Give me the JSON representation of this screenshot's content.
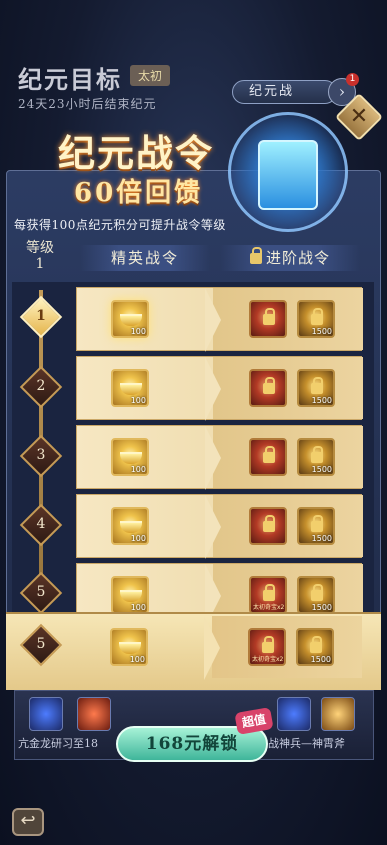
{
  "header": {
    "title": "纪元目标",
    "badge": "太初",
    "subtitle": "24天23小时后结束纪元",
    "war_button": "纪元战",
    "notify_count": "1"
  },
  "banner": {
    "title": "纪元战令",
    "subtitle": "60倍回馈",
    "description": "每获得100点纪元积分可提升战令等级"
  },
  "columns": {
    "level_label": "等级",
    "level_value": "1",
    "elite": "精英战令",
    "advanced": "进阶战令"
  },
  "rows": [
    {
      "level": "1",
      "elite_qty": "100",
      "adv_qty": "1500",
      "active": true
    },
    {
      "level": "2",
      "elite_qty": "100",
      "adv_qty": "1500"
    },
    {
      "level": "3",
      "elite_qty": "100",
      "adv_qty": "1500"
    },
    {
      "level": "4",
      "elite_qty": "100",
      "adv_qty": "1500"
    },
    {
      "level": "5",
      "elite_qty": "100",
      "adv_qty": "1500",
      "adv_tag": "太初奇宝x2"
    }
  ],
  "sticky_row": {
    "level": "5",
    "elite_qty": "100",
    "adv_qty": "1500",
    "adv_tag": "太初奇宝x2"
  },
  "bottom": {
    "left_text": "亢金龙研习至18",
    "right_text": "战神兵—神霄斧",
    "buy_label": "168元解锁",
    "buy_tag": "超值"
  },
  "icons": {
    "close": "close-icon",
    "arrow": "chevron-right-icon",
    "back": "back-arrow-icon"
  }
}
